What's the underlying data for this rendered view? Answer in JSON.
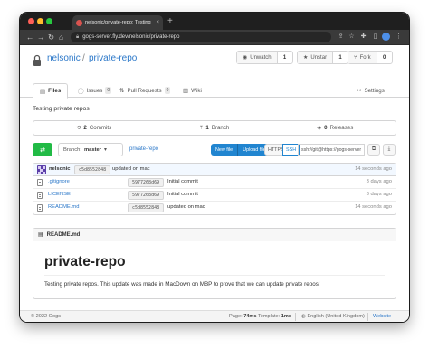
{
  "browser": {
    "tab_title": "nelsonic/private-repo: Testing",
    "tab_close": "×",
    "new_tab": "+",
    "url": "gogs-server.fly.dev/nelsonic/private-repo",
    "icons": [
      "back-arrow-icon",
      "forward-arrow-icon",
      "reload-icon",
      "home-icon",
      "lock-icon",
      "share-icon",
      "star-icon",
      "extension-icon",
      "sidebar-icon",
      "profile-icon",
      "menu-icon"
    ]
  },
  "repo": {
    "owner": "nelsonic",
    "separator": "/",
    "name": "private-repo",
    "description": "Testing private repos"
  },
  "actions": {
    "watch": {
      "label": "Unwatch",
      "count": "1"
    },
    "star": {
      "label": "Unstar",
      "count": "1"
    },
    "fork": {
      "label": "Fork",
      "count": "0"
    }
  },
  "tabs": {
    "files": "Files",
    "issues": "Issues",
    "issues_count": "0",
    "pulls": "Pull Requests",
    "pulls_count": "0",
    "wiki": "Wiki",
    "settings": "Settings"
  },
  "stats": {
    "commits_count": "2",
    "commits_label": "Commits",
    "branches_count": "1",
    "branches_label": "Branch",
    "releases_count": "0",
    "releases_label": "Releases"
  },
  "controls": {
    "branch_prefix": "Branch:",
    "branch": "master",
    "path": "private-repo",
    "new_file": "New file",
    "upload_file": "Upload file",
    "https": "HTTPS",
    "ssh": "SSH",
    "clone_url": "ssh://git@https://gogs-server"
  },
  "latest_commit": {
    "author": "nelsonic",
    "sha": "c5d8552848",
    "message": "updated on mac",
    "time": "14 seconds ago"
  },
  "files": [
    {
      "name": ".gitignore",
      "sha": "5977268d69",
      "message": "Initial commit",
      "time": "3 days ago"
    },
    {
      "name": "LICENSE",
      "sha": "5977268d69",
      "message": "Initial commit",
      "time": "3 days ago"
    },
    {
      "name": "README.md",
      "sha": "c5d8552848",
      "message": "updated on mac",
      "time": "14 seconds ago"
    }
  ],
  "readme": {
    "filename": "README.md",
    "title": "private-repo",
    "body": "Testing private repos. This update was made in MacDown on MBP to prove that we can update private repos!"
  },
  "footer": {
    "copyright": "© 2022 Gogs",
    "page_label": "Page:",
    "page_time": "74ms",
    "template_label": "Template:",
    "template_time": "1ms",
    "language": "English (United Kingdom)",
    "website": "Website"
  },
  "colors": {
    "link": "#2c78c9",
    "primary_button": "#2185d0",
    "create_button": "#21ba45",
    "commit_row_bg": "#f2f8ff"
  }
}
